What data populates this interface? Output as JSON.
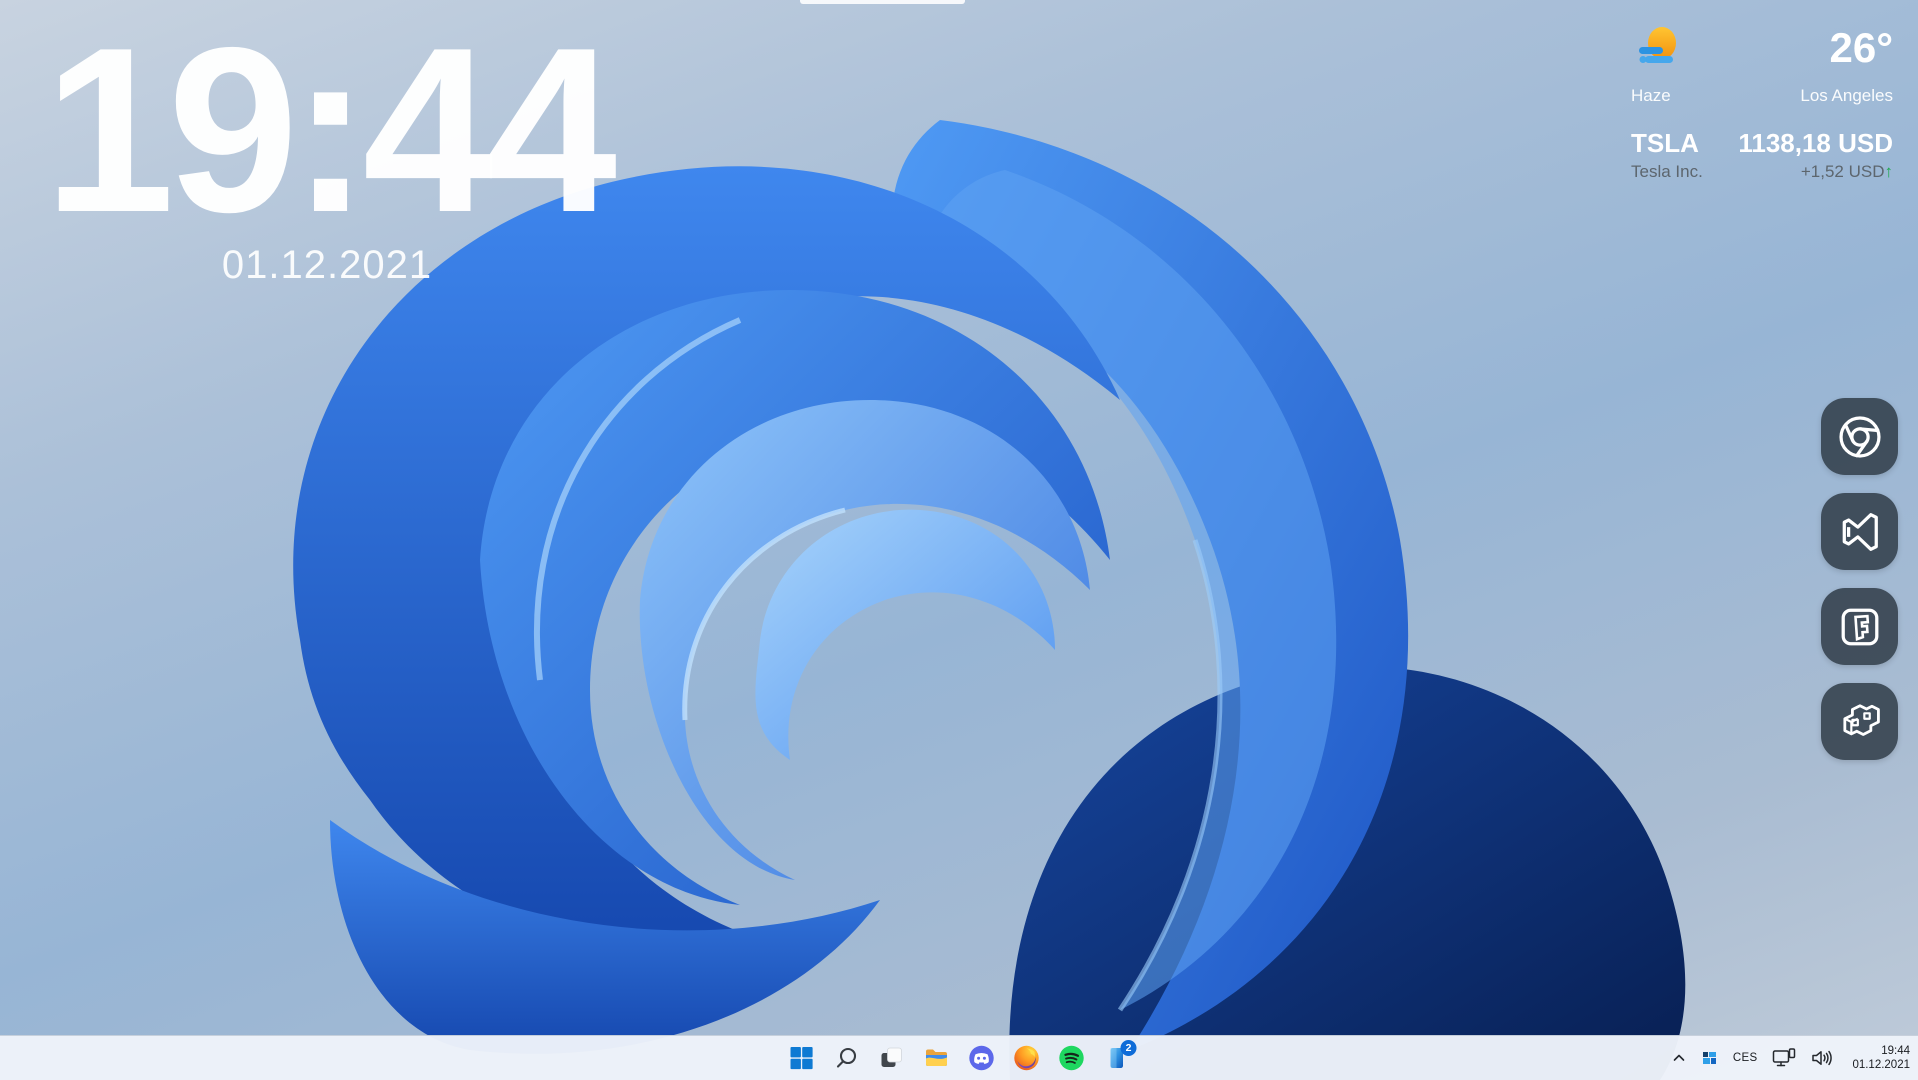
{
  "desktop": {
    "clock": {
      "time": "19:44",
      "date": "01.12.2021"
    },
    "weather": {
      "icon": "sun-haze-icon",
      "condition": "Haze",
      "temperature": "26°",
      "city": "Los Angeles"
    },
    "stock": {
      "symbol": "TSLA",
      "company": "Tesla Inc.",
      "price": "1138,18 USD",
      "change": "+1,52 USD",
      "trend_glyph": "↑",
      "trend": "up",
      "up_color": "#1fa94f"
    },
    "dock": {
      "items": [
        {
          "name": "chrome"
        },
        {
          "name": "visual-studio"
        },
        {
          "name": "fortnite"
        },
        {
          "name": "blocky-3d-app"
        }
      ],
      "button_bg": "rgba(45,56,67,0.83)"
    }
  },
  "taskbar": {
    "buttons": [
      "start",
      "search",
      "task-view",
      "file-explorer",
      "discord",
      "firefox",
      "spotify",
      "phone-link"
    ],
    "phone_badge": "2",
    "tray": {
      "language": "CES",
      "time": "19:44",
      "date": "01.12.2021",
      "icons": [
        "hidden-icons-chevron",
        "tray-app-tiles",
        "display-device",
        "volume"
      ]
    }
  },
  "colors": {
    "start_blue": "#0e7ad3",
    "discord": "#5c68ea",
    "spotify_green": "#1ed760",
    "badge_blue": "#0f6cd8",
    "taskbar_bg": "#eef3fa",
    "wallpaper_blue": "#2f7de8"
  }
}
